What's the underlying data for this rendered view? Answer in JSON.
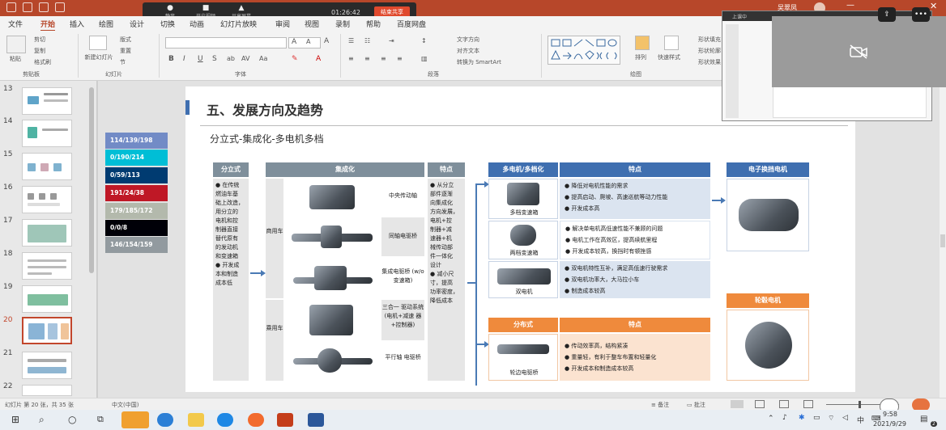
{
  "titlebar": {
    "user": "吴翠凤"
  },
  "meeting": {
    "tools": [
      {
        "icon": "mic-icon",
        "label": "静音"
      },
      {
        "icon": "camera-icon",
        "label": "开启视频"
      },
      {
        "icon": "share-icon",
        "label": "共享屏幕"
      }
    ],
    "timer": "01:26:42",
    "end_share": "结束共享"
  },
  "tabs": [
    "文件",
    "开始",
    "插入",
    "绘图",
    "设计",
    "切换",
    "动画",
    "幻灯片放映",
    "审阅",
    "视图",
    "录制",
    "帮助",
    "百度网盘"
  ],
  "ribbon": {
    "groups": [
      "剪贴板",
      "幻灯片",
      "字体",
      "段落",
      "绘图"
    ],
    "clipboard": {
      "paste": "粘贴",
      "cut": "剪切",
      "copy": "复制",
      "format_painter": "格式刷"
    },
    "slides": {
      "new": "新建幻灯片",
      "layout": "版式",
      "reset": "重置",
      "section": "节"
    },
    "paragraph": {
      "text_direction": "文字方向",
      "align_text": "对齐文本",
      "smartart": "转换为 SmartArt"
    },
    "drawing": {
      "arrange": "排列",
      "quick_styles": "快速样式",
      "fill": "形状填充",
      "outline": "形状轮廓",
      "effects": "形状效果"
    }
  },
  "thumbnails": {
    "numbers": [
      "13",
      "14",
      "15",
      "16",
      "17",
      "18",
      "19",
      "20",
      "21",
      "22"
    ],
    "selected": "20"
  },
  "legend": [
    {
      "label": "114/139/198",
      "color": "#728bc6"
    },
    {
      "label": "0/190/214",
      "color": "#00bed6"
    },
    {
      "label": "0/59/113",
      "color": "#003b71"
    },
    {
      "label": "191/24/38",
      "color": "#bf1826"
    },
    {
      "label": "179/185/172",
      "color": "#b3b9ac"
    },
    {
      "label": "0/0/8",
      "color": "#000008"
    },
    {
      "label": "146/154/159",
      "color": "#929a9f"
    }
  ],
  "slide": {
    "title": "五、发展方向及趋势",
    "subtitle": "分立式-集成化-多电机多档",
    "left_table": {
      "h_split": "分立式",
      "h_integrated": "集成化",
      "h_features": "特点",
      "split_text": [
        "● 在传统",
        "燃油车基",
        "础上改造，",
        "用分立的",
        "电机和控",
        "制器直接",
        "替代原有",
        "的发动机",
        "和变速箱",
        "● 开发成",
        "本和制造",
        "成本低"
      ],
      "commercial": "商用车",
      "passenger": "乘用车",
      "items": [
        "中央传动轴",
        "同轴电驱桥",
        "集成电驱桥 (w/o变速箱)",
        "三合一 驱动系统 (电机+减速 器+控制器)",
        "平行轴 电驱桥"
      ],
      "features_text": [
        "● 从分立",
        "部件逐渐",
        "向集成化",
        "方向发展，",
        "电机+控",
        "制器+减",
        "速器+机",
        "械传动部",
        "件一体化",
        "设计",
        "● 减小尺",
        "寸，提高",
        "功率密度，",
        "降低成本"
      ]
    },
    "multi": {
      "h_left": "多电机/多档化",
      "h_right": "特点",
      "rows": [
        {
          "name": "多档变速箱",
          "bullets": [
            "降低对电机性能的需求",
            "提高启动、爬坡、高速巡航等动力性能",
            "开发成本高"
          ]
        },
        {
          "name": "两档变速箱",
          "bullets": [
            "解决单电机高低速性能不兼顾的问题",
            "电机工作在高效区，提高续航里程",
            "开发成本较高，换挡时有顿挫感"
          ]
        },
        {
          "name": "双电机",
          "bullets": [
            "双电机特性互补，满足高低速行驶需求",
            "双电机功率大，大马拉小车",
            "制造成本较高"
          ]
        }
      ]
    },
    "dist": {
      "h_left": "分布式",
      "h_right": "特点",
      "name": "轮边电驱桥",
      "bullets": [
        "传动效率高，结构紧凑",
        "重量轻，有利于整车布置和轻量化",
        "开发成本和制造成本较高"
      ]
    },
    "right_boxes": {
      "swap": "电子换挡电机",
      "hub": "轮毂电机"
    }
  },
  "status": {
    "slide_info": "幻灯片 第 20 张，共 35 张",
    "language": "中文(中国)",
    "notes": "备注",
    "comments": "批注"
  },
  "taskbar": {
    "time": "9:58",
    "date": "2021/9/29",
    "ime": "中",
    "notif_count": "2"
  },
  "share_overlay": {
    "label": "上课中"
  }
}
